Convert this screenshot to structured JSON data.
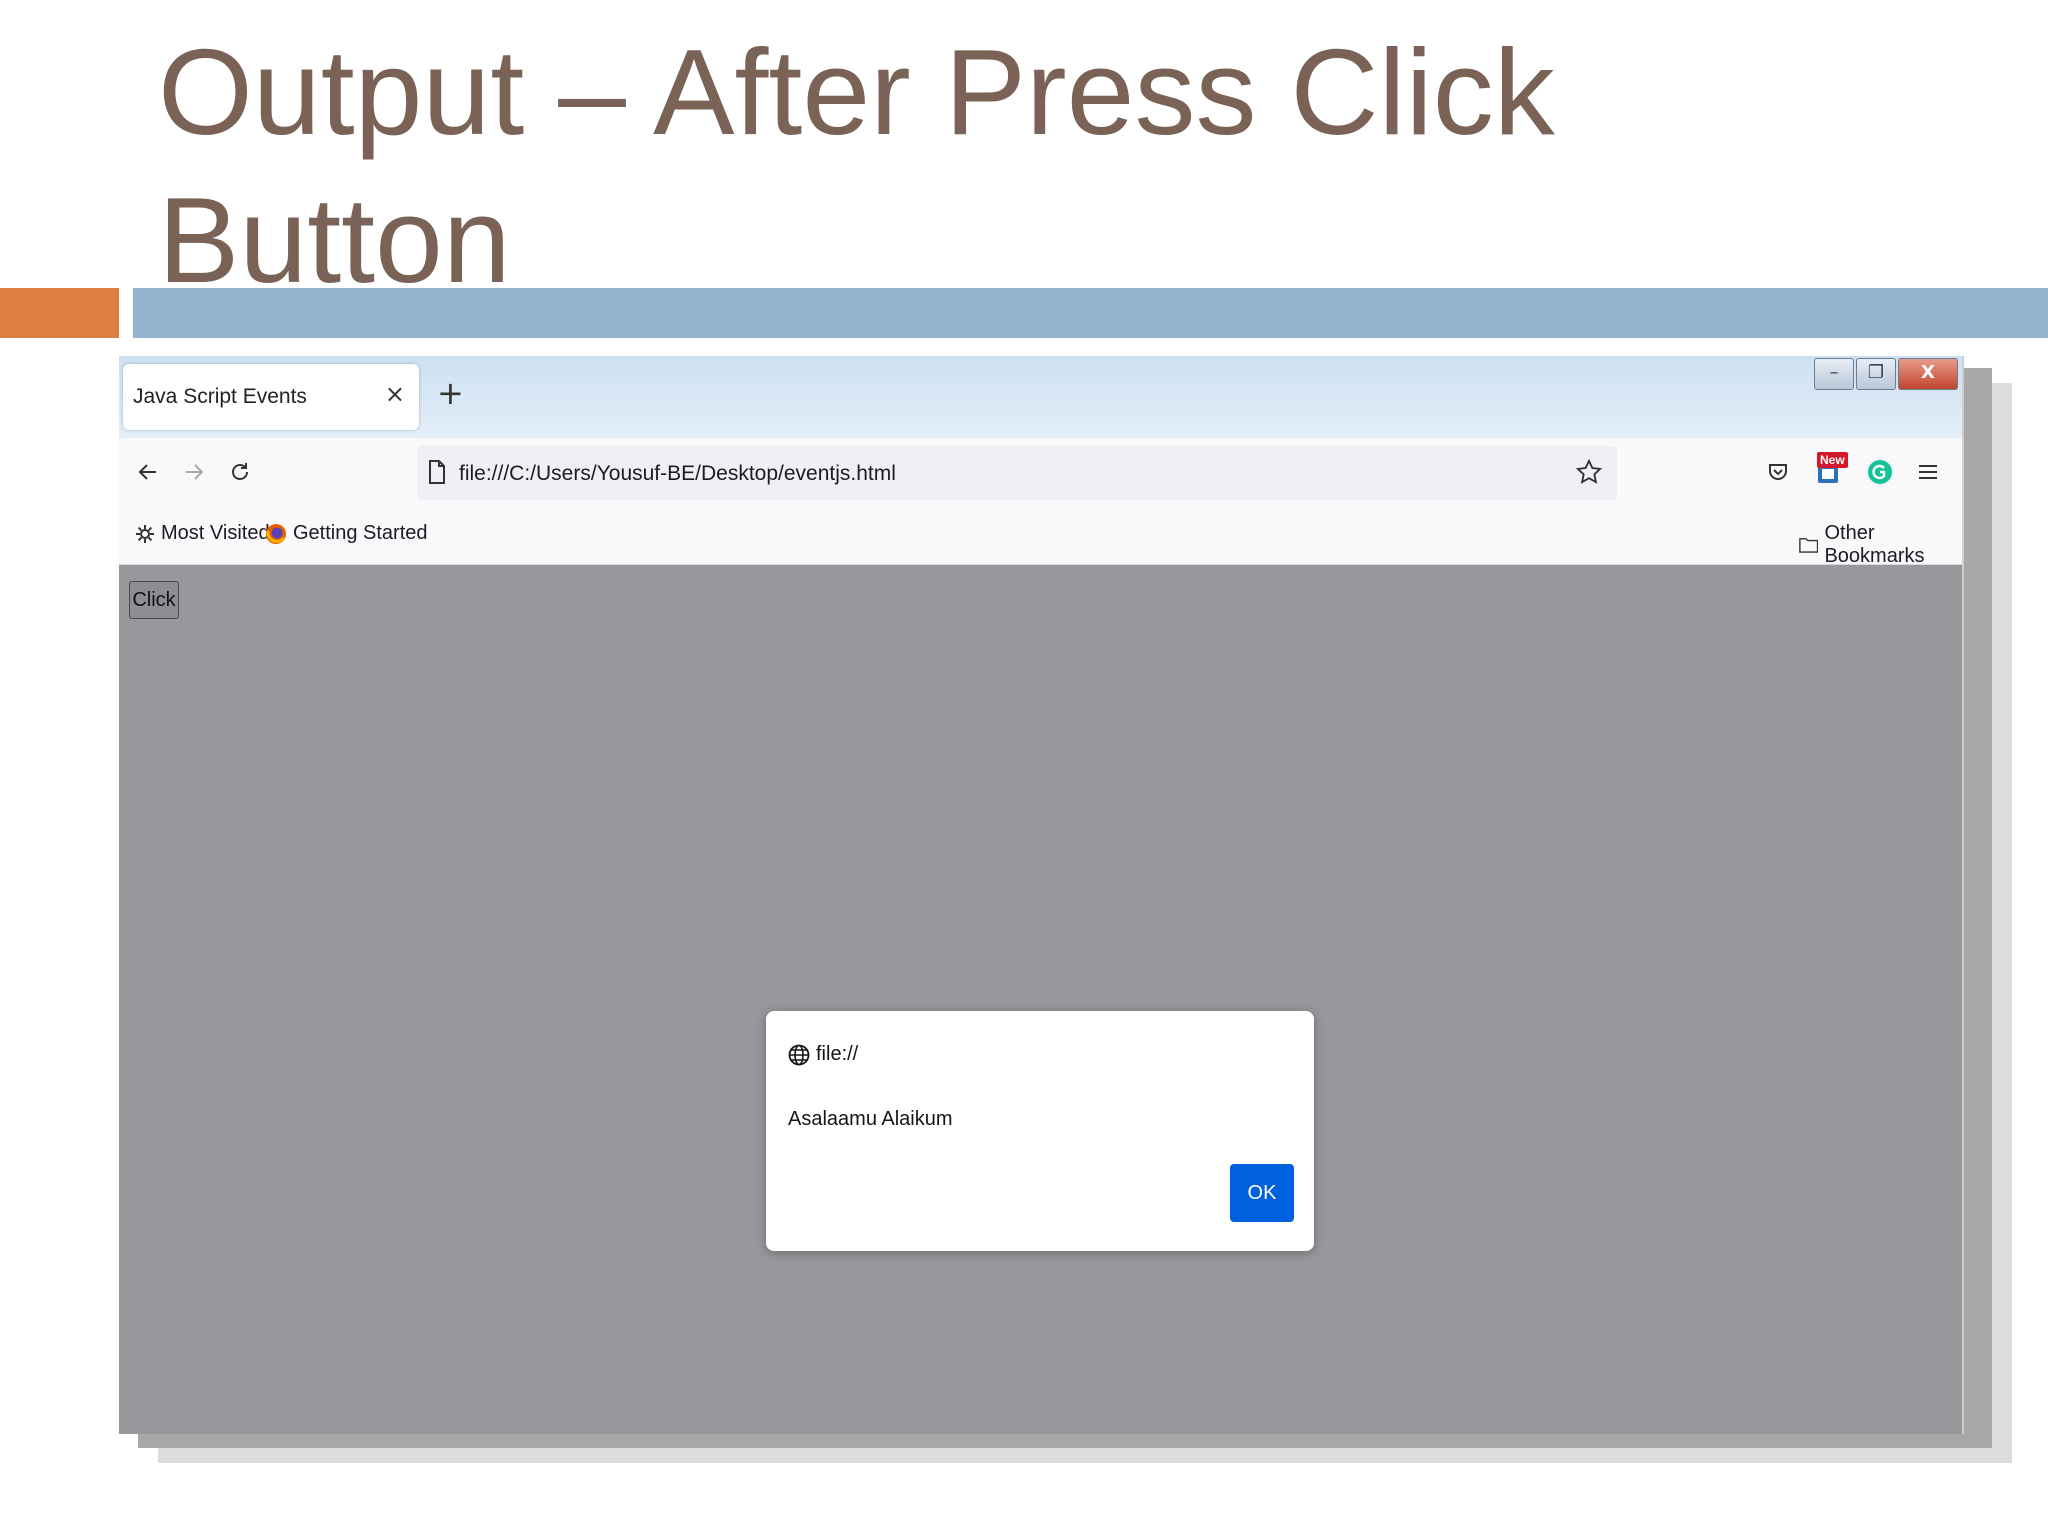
{
  "slide": {
    "title": "Output – After Press Click\nButton",
    "colors": {
      "title": "#7a6356",
      "accent_orange": "#de7f44",
      "accent_blue": "#93b3cf"
    }
  },
  "browser": {
    "window_controls": {
      "minimize": "–",
      "restore": "❐",
      "close": "X"
    },
    "tab": {
      "title": "Java Script Events",
      "close": "×"
    },
    "new_tab": "+",
    "nav": {
      "back_icon": "arrow-left-icon",
      "forward_icon": "arrow-right-icon",
      "reload_icon": "reload-icon",
      "url": "file:///C:/Users/Yousuf-BE/Desktop/eventjs.html"
    },
    "toolbar_icons": [
      "pocket-icon",
      "extension-new-icon",
      "grammarly-icon",
      "menu-icon"
    ],
    "new_badge": "New",
    "bookmarks": {
      "most_visited": "Most Visited",
      "getting_started": "Getting Started",
      "other_bookmarks": "Other Bookmarks"
    }
  },
  "page": {
    "button_label": "Click",
    "background": "#98979b"
  },
  "alert": {
    "origin": "file://",
    "message": "Asalaamu Alaikum",
    "ok_label": "OK",
    "ok_color": "#0061e0"
  }
}
